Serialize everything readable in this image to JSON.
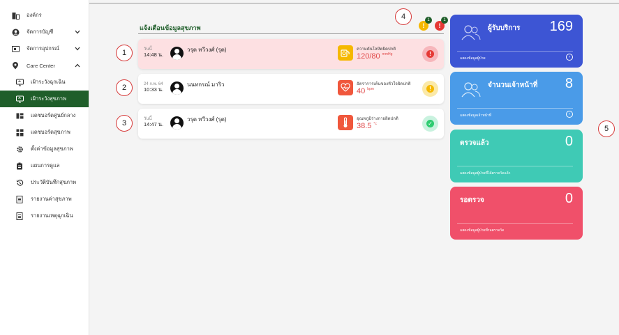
{
  "sidebar": {
    "items": [
      {
        "label": "องค์กร",
        "icon": "building-icon"
      },
      {
        "label": "จัดการบัญชี",
        "icon": "user-circle-icon"
      },
      {
        "label": "จัดการอุปกรณ์",
        "icon": "device-icon"
      },
      {
        "label": "Care Center",
        "icon": "location-pin-icon"
      }
    ],
    "sub_items": [
      {
        "label": "เฝ้าระวังฉุกเฉิน",
        "icon": "monitor-icon"
      },
      {
        "label": "เฝ้าระวังสุขภาพ",
        "icon": "monitor-icon"
      },
      {
        "label": "แดชบอร์ดศูนย์กลาง",
        "icon": "dashboard-icon"
      },
      {
        "label": "แดชบอร์ดสุขภาพ",
        "icon": "grid-icon"
      },
      {
        "label": "ตั้งค่าข้อมูลสุขภาพ",
        "icon": "gear-icon"
      },
      {
        "label": "แผนการดูแล",
        "icon": "clipboard-icon"
      },
      {
        "label": "ประวัติบันทึกสุขภาพ",
        "icon": "history-icon"
      },
      {
        "label": "รายงานค่าสุขภาพ",
        "icon": "report-icon"
      },
      {
        "label": "รายงานเหตุฉุกเฉิน",
        "icon": "report-icon"
      }
    ]
  },
  "notifications": {
    "title": "แจ้งเตือนข้อมูลสุขภาพ",
    "header_badges": [
      {
        "icon": "warning-icon",
        "count": "1",
        "color": "#f5b800"
      },
      {
        "icon": "alert-icon",
        "count": "1",
        "color": "#e53935"
      }
    ],
    "cards": [
      {
        "date": "วันนี้",
        "time": "14:48 น.",
        "name": "วรุต ทวีวงศ์ (รุต)",
        "metric_label": "ความดันโลหิตผิดปกติ",
        "metric_value": "120/80",
        "metric_unit": "mmHg",
        "metric_icon": "blood-pressure-icon",
        "metric_color": "#f5b800",
        "status": "critical",
        "status_glyph": "!"
      },
      {
        "date": "24 ก.พ. 64",
        "time": "10:33 น.",
        "name": "นนทกรณ์ มาริว",
        "metric_label": "อัตราการเต้นของหัวใจผิดปกติ",
        "metric_value": "40",
        "metric_unit": "bpm",
        "metric_icon": "heart-rate-icon",
        "metric_color": "#f0573c",
        "status": "warning",
        "status_glyph": "!"
      },
      {
        "date": "วันนี้",
        "time": "14:47 น.",
        "name": "วรุต ทวีวงศ์ (รุต)",
        "metric_label": "อุณหภูมิร่างกายผิดปกติ",
        "metric_value": "38.5",
        "metric_unit": "°c",
        "metric_icon": "thermometer-icon",
        "metric_color": "#f0573c",
        "status": "ok",
        "status_glyph": "✓"
      }
    ]
  },
  "callouts": [
    "1",
    "2",
    "3",
    "4",
    "5"
  ],
  "tiles": [
    {
      "title": "ผู้รับบริการ",
      "value": "169",
      "footer": "แสดงข้อมูลผู้ป่วย",
      "color": "#3d55d4",
      "has_icon": true
    },
    {
      "title": "จำนวนเจ้าหน้าที่",
      "value": "8",
      "footer": "แสดงข้อมูลเจ้าหน้าที่",
      "color": "#4a9be8",
      "has_icon": true
    },
    {
      "title": "ตรวจแล้ว",
      "value": "0",
      "footer": "แสดงข้อมูลผู้ป่วยที่ได้ตรวจวัดแล้ว",
      "color": "#3fcab5",
      "has_icon": false
    },
    {
      "title": "รอตรวจ",
      "value": "0",
      "footer": "แสดงข้อมูลผู้ป่วยที่รอตรวจวัด",
      "color": "#f0506a",
      "has_icon": false
    }
  ]
}
